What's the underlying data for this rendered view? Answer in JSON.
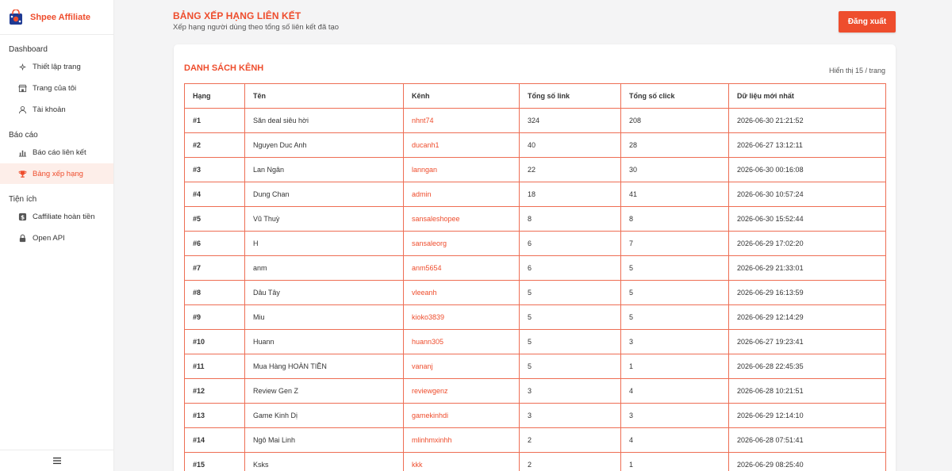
{
  "brand": {
    "name": "Shpee Affiliate"
  },
  "sidebar": {
    "groups": [
      {
        "label": "Dashboard",
        "items": [
          {
            "label": "Thiết lập trang",
            "icon": "settings-icon"
          },
          {
            "label": "Trang của tôi",
            "icon": "store-icon"
          },
          {
            "label": "Tài khoản",
            "icon": "user-icon"
          }
        ]
      },
      {
        "label": "Báo cáo",
        "items": [
          {
            "label": "Báo cáo liên kết",
            "icon": "chart-icon"
          },
          {
            "label": "Bảng xếp hạng",
            "icon": "trophy-icon",
            "active": true
          }
        ]
      },
      {
        "label": "Tiện ích",
        "items": [
          {
            "label": "Caffiliate hoàn tiền",
            "icon": "dollar-icon"
          },
          {
            "label": "Open API",
            "icon": "lock-icon"
          }
        ]
      }
    ]
  },
  "header": {
    "title": "BẢNG XẾP HẠNG LIÊN KẾT",
    "subtitle": "Xếp hạng người dùng theo tổng số liên kết đã tạo",
    "logout_label": "Đăng xuất"
  },
  "card": {
    "title": "DANH SÁCH KÊNH",
    "meta": "Hiển thị 15 / trang"
  },
  "table": {
    "columns": [
      "Hạng",
      "Tên",
      "Kênh",
      "Tổng số link",
      "Tổng số click",
      "Dữ liệu mới nhất"
    ],
    "rows": [
      [
        "#1",
        "Săn deal siêu hời",
        "nhnt74",
        "324",
        "208",
        "2026-06-30 21:21:52"
      ],
      [
        "#2",
        "Nguyen Duc Anh",
        "ducanh1",
        "40",
        "28",
        "2026-06-27 13:12:11"
      ],
      [
        "#3",
        "Lan Ngân",
        "lanngan",
        "22",
        "30",
        "2026-06-30 00:16:08"
      ],
      [
        "#4",
        "Dung Chan",
        "admin",
        "18",
        "41",
        "2026-06-30 10:57:24"
      ],
      [
        "#5",
        "Vũ Thuỳ",
        "sansaleshopee",
        "8",
        "8",
        "2026-06-30 15:52:44"
      ],
      [
        "#6",
        "H",
        "sansaleorg",
        "6",
        "7",
        "2026-06-29 17:02:20"
      ],
      [
        "#7",
        "anm",
        "anm5654",
        "6",
        "5",
        "2026-06-29 21:33:01"
      ],
      [
        "#8",
        "Dâu Tây",
        "vleeanh",
        "5",
        "5",
        "2026-06-29 16:13:59"
      ],
      [
        "#9",
        "Miu",
        "kioko3839",
        "5",
        "5",
        "2026-06-29 12:14:29"
      ],
      [
        "#10",
        "Huann",
        "huann305",
        "5",
        "3",
        "2026-06-27 19:23:41"
      ],
      [
        "#11",
        "Mua Hàng HOÀN TIỀN",
        "vananj",
        "5",
        "1",
        "2026-06-28 22:45:35"
      ],
      [
        "#12",
        "Review Gen Z",
        "reviewgenz",
        "3",
        "4",
        "2026-06-28 10:21:51"
      ],
      [
        "#13",
        "Game Kinh Dị",
        "gamekinhdi",
        "3",
        "3",
        "2026-06-29 12:14:10"
      ],
      [
        "#14",
        "Ngô Mai Linh",
        "mlinhmxinhh",
        "2",
        "4",
        "2026-06-28 07:51:41"
      ],
      [
        "#15",
        "Ksks",
        "kkk",
        "2",
        "1",
        "2026-06-29 08:25:40"
      ]
    ]
  },
  "colors": {
    "accent": "#ee4d2d",
    "active_bg": "#fdeee9"
  }
}
